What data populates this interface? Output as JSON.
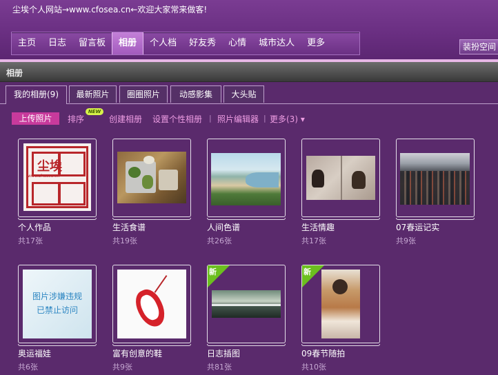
{
  "header": {
    "tagline": "尘埃个人网站→www.cfosea.cn←欢迎大家常来做客!",
    "dress_space_label": "装扮空间"
  },
  "nav": {
    "items": [
      "主页",
      "日志",
      "留言板",
      "相册",
      "个人档",
      "好友秀",
      "心情",
      "城市达人",
      "更多"
    ],
    "active": "相册"
  },
  "section": {
    "title": "相册"
  },
  "tabs": [
    "我的相册(9)",
    "最新照片",
    "圈圈照片",
    "动感影集",
    "大头贴"
  ],
  "actions": {
    "upload": "上传照片",
    "sort": "排序",
    "new_badge": "NEW",
    "create_album": "创建相册",
    "custom_album": "设置个性相册",
    "photo_editor": "照片编辑器",
    "more": "更多(3)"
  },
  "albums": [
    {
      "title": "个人作品",
      "count": "共17张",
      "thumb_icon": "red-seal-image",
      "seal_text": "尘埃",
      "seal_url": "www.zhusea.cn"
    },
    {
      "title": "生活食谱",
      "count": "共19张",
      "thumb_icon": "food-tray-image"
    },
    {
      "title": "人间色谱",
      "count": "共26张",
      "thumb_icon": "coastline-image"
    },
    {
      "title": "生活情趣",
      "count": "共17张",
      "thumb_icon": "dogs-image"
    },
    {
      "title": "07春运记实",
      "count": "共9张",
      "thumb_icon": "crowd-image"
    },
    {
      "title": "奥运福娃",
      "count": "共6张",
      "thumb_icon": "blocked-image",
      "blocked_line1": "图片涉嫌违规",
      "blocked_line2": "已禁止访问"
    },
    {
      "title": "富有创意的鞋",
      "count": "共9张",
      "thumb_icon": "red-shoe-image"
    },
    {
      "title": "日志插图",
      "count": "共81张",
      "thumb_icon": "landscape-image",
      "new_label": "新"
    },
    {
      "title": "09春节随拍",
      "count": "共10张",
      "thumb_icon": "portrait-image",
      "new_label": "新"
    }
  ],
  "colors": {
    "page_bg": "#5a2a6c",
    "accent": "#c83a9c",
    "link": "#ee9de3",
    "new_badge": "#6cbf1f"
  }
}
